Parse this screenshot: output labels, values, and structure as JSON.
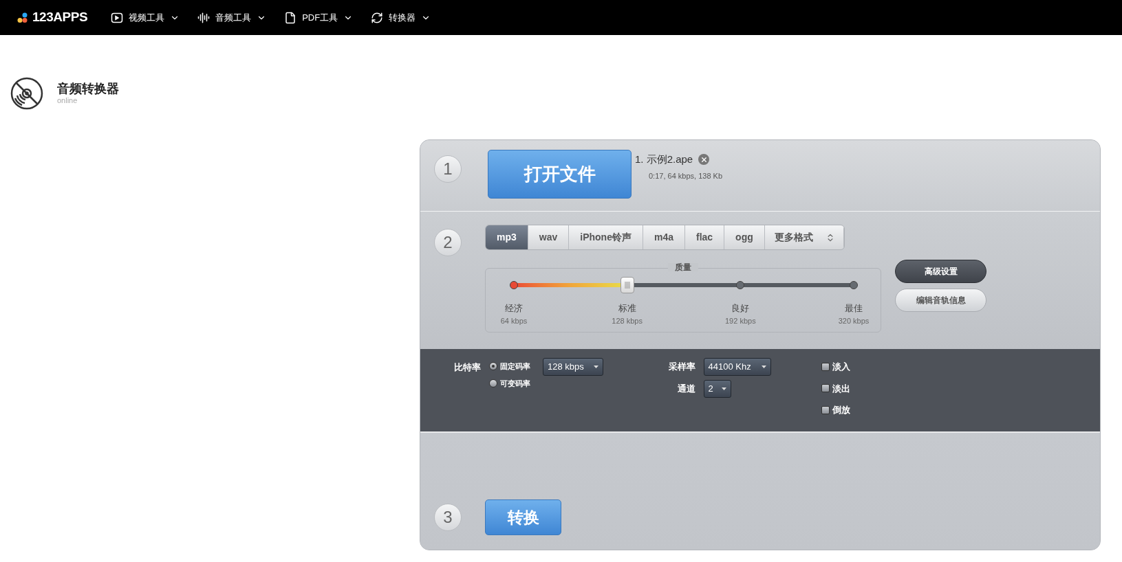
{
  "nav": {
    "logo": "123APPS",
    "items": [
      {
        "label": "视频工具",
        "kind": "video"
      },
      {
        "label": "音频工具",
        "kind": "audio"
      },
      {
        "label": "PDF工具",
        "kind": "pdf"
      },
      {
        "label": "转换器",
        "kind": "converter"
      }
    ]
  },
  "app_title": {
    "title": "音频转换器",
    "subtitle": "online"
  },
  "step1": {
    "number": "1",
    "button": "打开文件",
    "files": [
      {
        "name": "1. 示例2.ape",
        "info": "0:17, 64 kbps, 138 Kb"
      }
    ]
  },
  "step2": {
    "number": "2",
    "formats": [
      {
        "label": "mp3",
        "selected": true,
        "kind": "format"
      },
      {
        "label": "wav",
        "selected": false,
        "kind": "format"
      },
      {
        "label": "iPhone铃声",
        "selected": false,
        "kind": "format"
      },
      {
        "label": "m4a",
        "selected": false,
        "kind": "format"
      },
      {
        "label": "flac",
        "selected": false,
        "kind": "format"
      },
      {
        "label": "ogg",
        "selected": false,
        "kind": "format"
      },
      {
        "label": "更多格式",
        "selected": false,
        "kind": "dropdown"
      }
    ],
    "quality": {
      "legend": "质量",
      "level": 0.333,
      "stops": [
        {
          "label": "经济",
          "reading": "64 kbps"
        },
        {
          "label": "标准",
          "reading": "128 kbps"
        },
        {
          "label": "良好",
          "reading": "192 kbps"
        },
        {
          "label": "最佳",
          "reading": "320 kbps"
        }
      ]
    },
    "buttons": [
      {
        "label": "高级设置",
        "selected": true
      },
      {
        "label": "编辑音轨信息",
        "selected": false
      }
    ]
  },
  "advanced": {
    "bitrate": {
      "label": "比特率",
      "modes": [
        {
          "label": "固定码率",
          "selected": true
        },
        {
          "label": "可变码率",
          "selected": false
        }
      ],
      "value": "128 kbps"
    },
    "sample_rate": {
      "label": "采样率",
      "value": "44100 Khz"
    },
    "channels": {
      "label": "通道",
      "value": "2"
    },
    "effects": [
      {
        "label": "淡入",
        "checked": false
      },
      {
        "label": "淡出",
        "checked": false
      },
      {
        "label": "倒放",
        "checked": false
      }
    ]
  },
  "step3": {
    "number": "3",
    "button": "转换"
  }
}
